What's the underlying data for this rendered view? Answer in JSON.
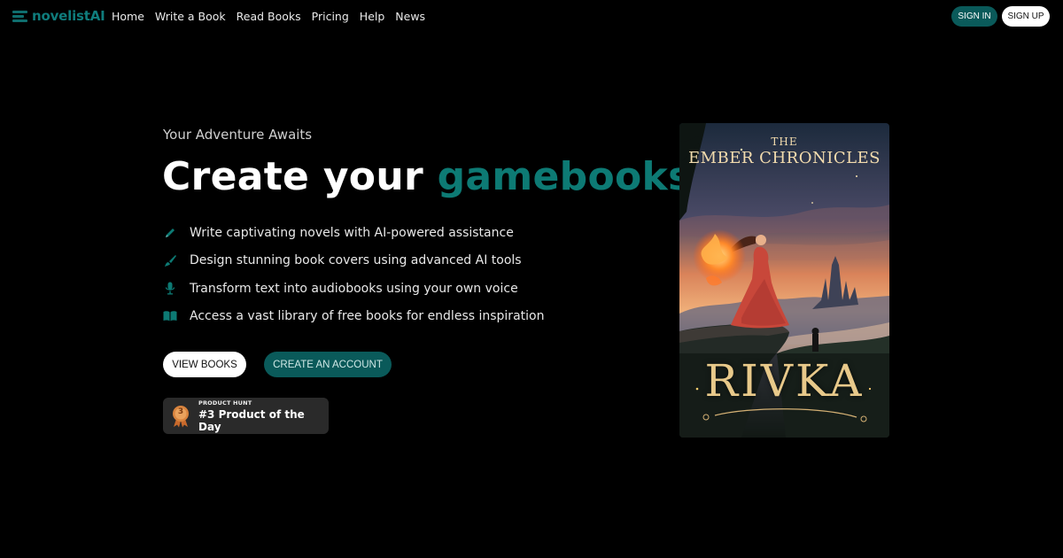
{
  "nav": {
    "logo_text": "novelistAI",
    "links": [
      "Home",
      "Write a Book",
      "Read Books",
      "Pricing",
      "Help",
      "News"
    ],
    "sign_in": "SIGN IN",
    "sign_up": "SIGN UP"
  },
  "hero": {
    "eyebrow": "Your Adventure Awaits",
    "headline_plain": "Create your ",
    "headline_accent": "gamebooks",
    "features": [
      {
        "icon": "pen-icon",
        "text": "Write captivating novels with AI-powered assistance"
      },
      {
        "icon": "brush-icon",
        "text": "Design stunning book covers using advanced AI tools"
      },
      {
        "icon": "microphone-icon",
        "text": "Transform text into audiobooks using your own voice"
      },
      {
        "icon": "book-open-icon",
        "text": "Access a vast library of free books for endless inspiration"
      }
    ],
    "view_books": "VIEW BOOKS",
    "create_account": "CREATE AN ACCOUNT"
  },
  "product_hunt": {
    "label": "PRODUCT HUNT",
    "rank": "3",
    "title": "#3 Product of the Day"
  },
  "cover": {
    "the": "THE",
    "series": "EMBER CHRONICLES",
    "title": "RIVKA"
  },
  "colors": {
    "accent": "#0d7a74",
    "button_teal": "#0a5a5a",
    "background": "#000000"
  }
}
